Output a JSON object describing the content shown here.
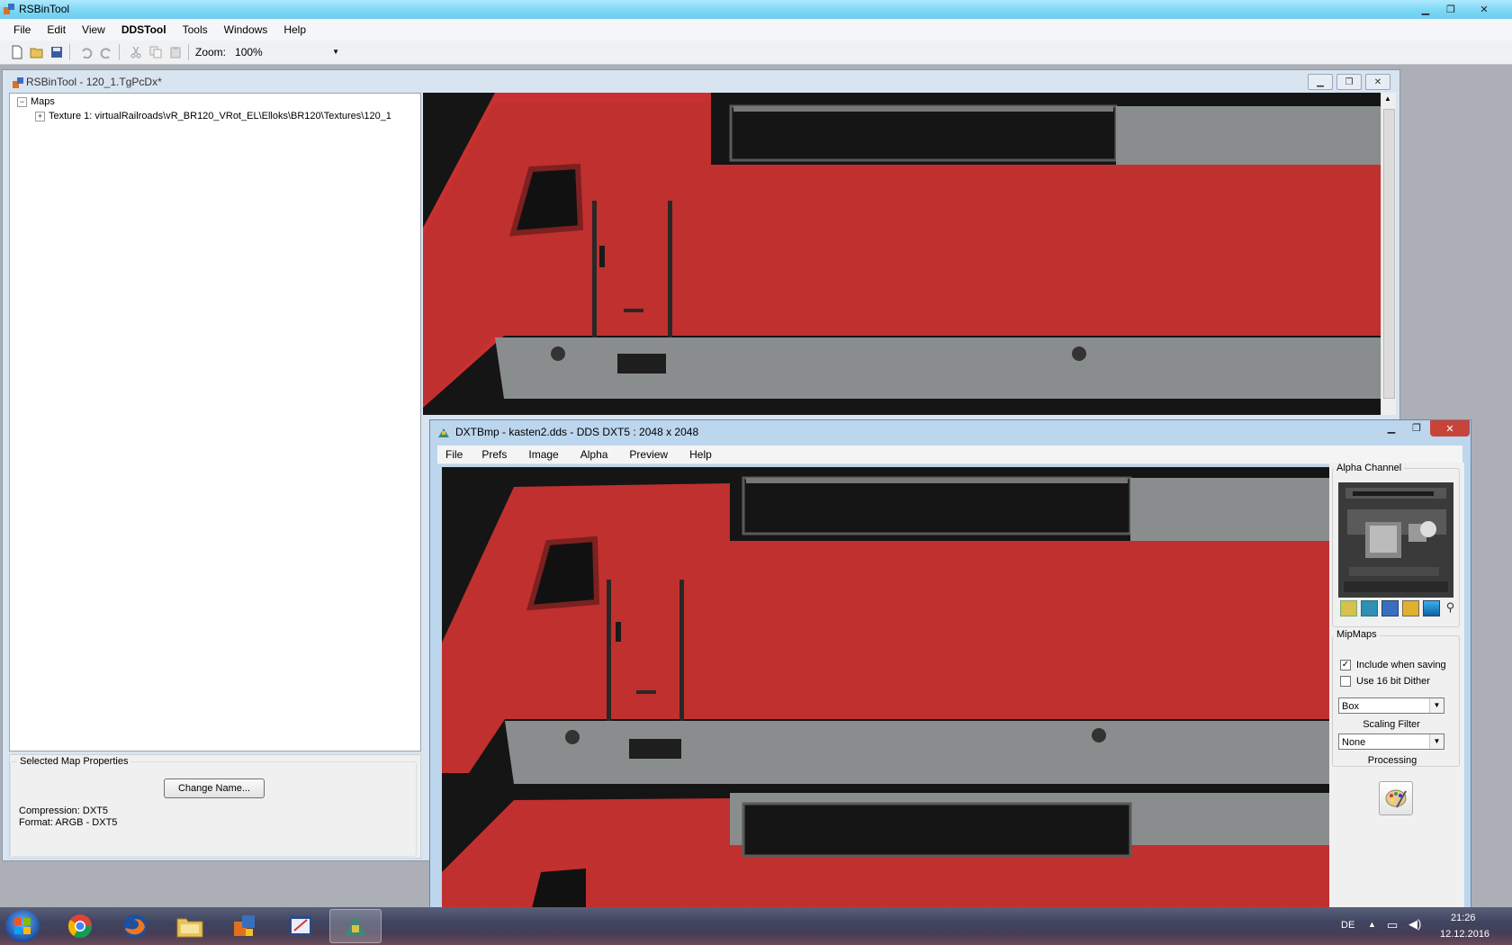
{
  "app": {
    "title": "RSBinTool"
  },
  "menubar": {
    "items": [
      "File",
      "Edit",
      "View",
      "DDSTool",
      "Tools",
      "Windows",
      "Help"
    ]
  },
  "toolbar": {
    "zoom_label": "Zoom:",
    "zoom_value": "100%",
    "icons": [
      "new-icon",
      "open-icon",
      "save-icon",
      "undo-icon",
      "redo-icon",
      "cut-icon",
      "copy-icon",
      "paste-icon"
    ]
  },
  "child": {
    "title": "RSBinTool - 120_1.TgPcDx*",
    "tree": {
      "root": "Maps",
      "node": "Texture 1: virtualRailroads\\vR_BR120_VRot_EL\\Elloks\\BR120\\Textures\\120_1"
    },
    "props": {
      "group_label": "Selected Map Properties",
      "change_name_button": "Change Name...",
      "compression": "Compression: DXT5",
      "format": "Format: ARGB - DXT5"
    }
  },
  "dxt": {
    "title": "DXTBmp - kasten2.dds - DDS DXT5 : 2048 x 2048",
    "menu": [
      "File",
      "Prefs",
      "Image",
      "Alpha",
      "Preview",
      "Help"
    ],
    "alpha_channel_label": "Alpha Channel",
    "mipmaps_label": "MipMaps",
    "include_when_saving": "Include when saving",
    "include_checked": true,
    "use_16bit_dither": "Use 16 bit Dither",
    "dither_checked": false,
    "scaling_value": "Box",
    "scaling_label": "Scaling Filter",
    "processing_value": "None",
    "processing_label": "Processing"
  },
  "taskbar": {
    "language": "DE",
    "time": "21:26",
    "date": "12.12.2016"
  },
  "colors": {
    "loco_red": "#c8312f",
    "loco_grey": "#8c8f8f",
    "canvas_bg": "#151515"
  }
}
